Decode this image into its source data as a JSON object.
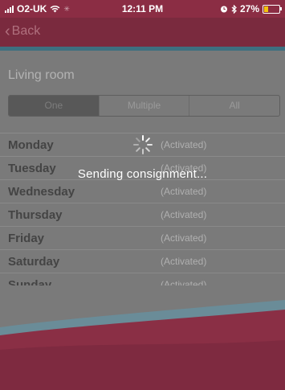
{
  "status_bar": {
    "carrier": "O2-UK",
    "time": "12:11 PM",
    "battery": "27%"
  },
  "nav": {
    "back_label": "Back"
  },
  "room": {
    "title": "Living room"
  },
  "segments": [
    {
      "label": "One",
      "selected": true
    },
    {
      "label": "Multiple",
      "selected": false
    },
    {
      "label": "All",
      "selected": false
    }
  ],
  "days": [
    {
      "name": "Monday",
      "status": "(Activated)"
    },
    {
      "name": "Tuesday",
      "status": "(Activated)"
    },
    {
      "name": "Wednesday",
      "status": "(Activated)"
    },
    {
      "name": "Thursday",
      "status": "(Activated)"
    },
    {
      "name": "Friday",
      "status": "(Activated)"
    },
    {
      "name": "Saturday",
      "status": "(Activated)"
    },
    {
      "name": "Sunday",
      "status": "(Activated)"
    }
  ],
  "overlay": {
    "message": "Sending consignment..."
  },
  "colors": {
    "brand": "#8b2d44",
    "accent_stripe": "#3d6f80",
    "battery_low": "#f2c20c"
  }
}
